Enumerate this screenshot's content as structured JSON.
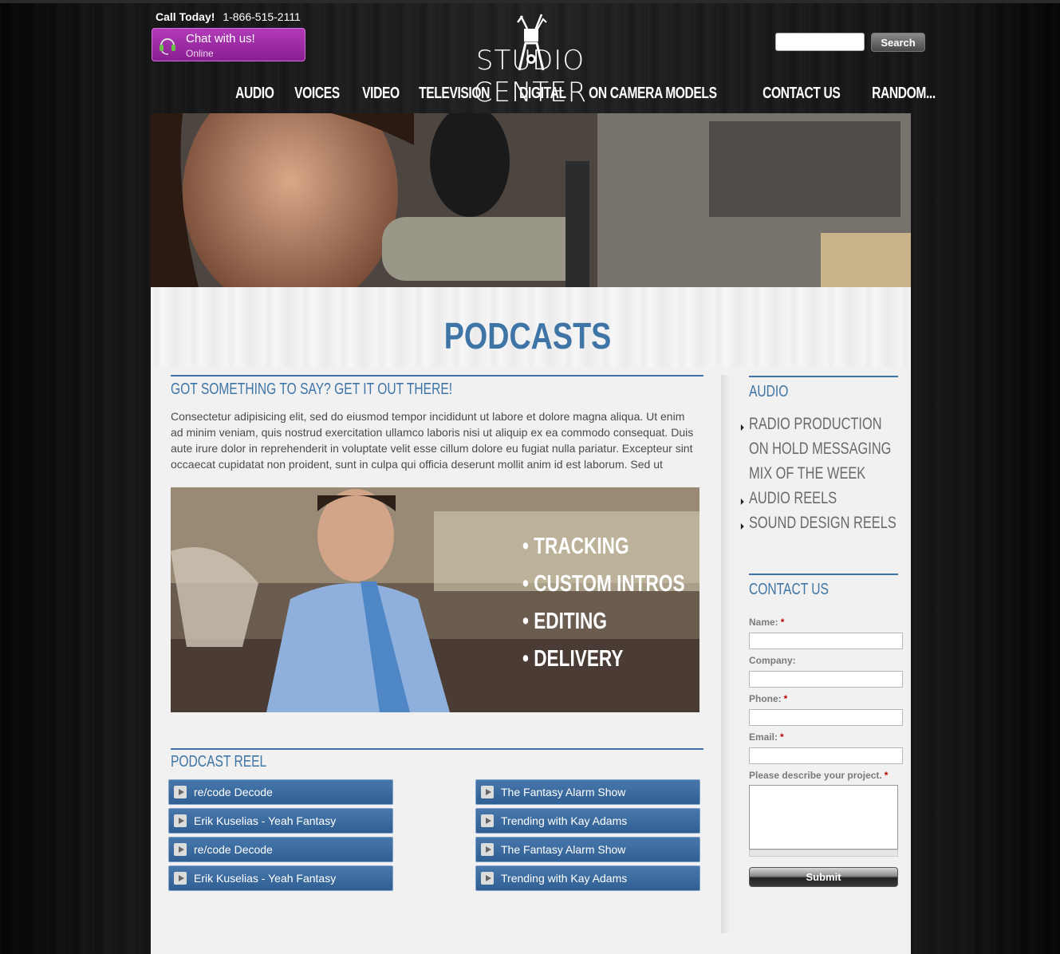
{
  "header": {
    "call_label": "Call Today!",
    "phone": "1-866-515-2111",
    "chat_title": "Chat with us!",
    "chat_status": "Online",
    "logo_text": "STUDIO CENTER",
    "search_placeholder": "",
    "search_button": "Search"
  },
  "nav": {
    "items": [
      "AUDIO",
      "VOICES",
      "VIDEO",
      "TELEVISION",
      "DIGITAL",
      "ON CAMERA MODELS",
      "CONTACT US",
      "RANDOM..."
    ]
  },
  "main": {
    "page_title": "PODCASTS",
    "intro_heading": "GOT SOMETHING TO SAY? GET IT OUT THERE!",
    "intro_text": "Consectetur adipisicing elit, sed do eiusmod tempor incididunt ut labore et dolore magna aliqua. Ut enim ad minim veniam, quis nostrud exercitation ullamco laboris nisi ut aliquip ex ea commodo consequat. Duis aute irure dolor in reprehenderit in voluptate velit esse cillum dolore eu fugiat nulla pariatur. Excepteur sint occaecat cupidatat non proident, sunt in culpa qui officia deserunt mollit anim id est laborum. Sed ut",
    "promo_items": [
      "• TRACKING",
      "• CUSTOM INTROS",
      "• EDITING",
      "• DELIVERY"
    ],
    "reel_heading": "PODCAST REEL",
    "reels_left": [
      "re/code Decode",
      "Erik Kuselias - Yeah Fantasy",
      "re/code Decode",
      "Erik Kuselias - Yeah Fantasy"
    ],
    "reels_right": [
      "The Fantasy Alarm Show",
      "Trending with Kay Adams",
      "The Fantasy Alarm Show",
      "Trending with Kay Adams"
    ]
  },
  "sidebar": {
    "audio_heading": "AUDIO",
    "audio_items": [
      "RADIO PRODUCTION",
      "ON HOLD MESSAGING",
      "MIX OF THE WEEK",
      "AUDIO REELS",
      "SOUND DESIGN REELS"
    ],
    "contact_heading": "CONTACT US",
    "form": {
      "name_label": "Name:",
      "company_label": "Company:",
      "phone_label": "Phone:",
      "email_label": "Email:",
      "project_label": "Please describe your project.",
      "required_mark": "*",
      "submit_label": "Submit"
    }
  },
  "colors": {
    "accent": "#3f75a6",
    "chat": "#9a2aa2",
    "button_blue": "#3b6b9e"
  }
}
